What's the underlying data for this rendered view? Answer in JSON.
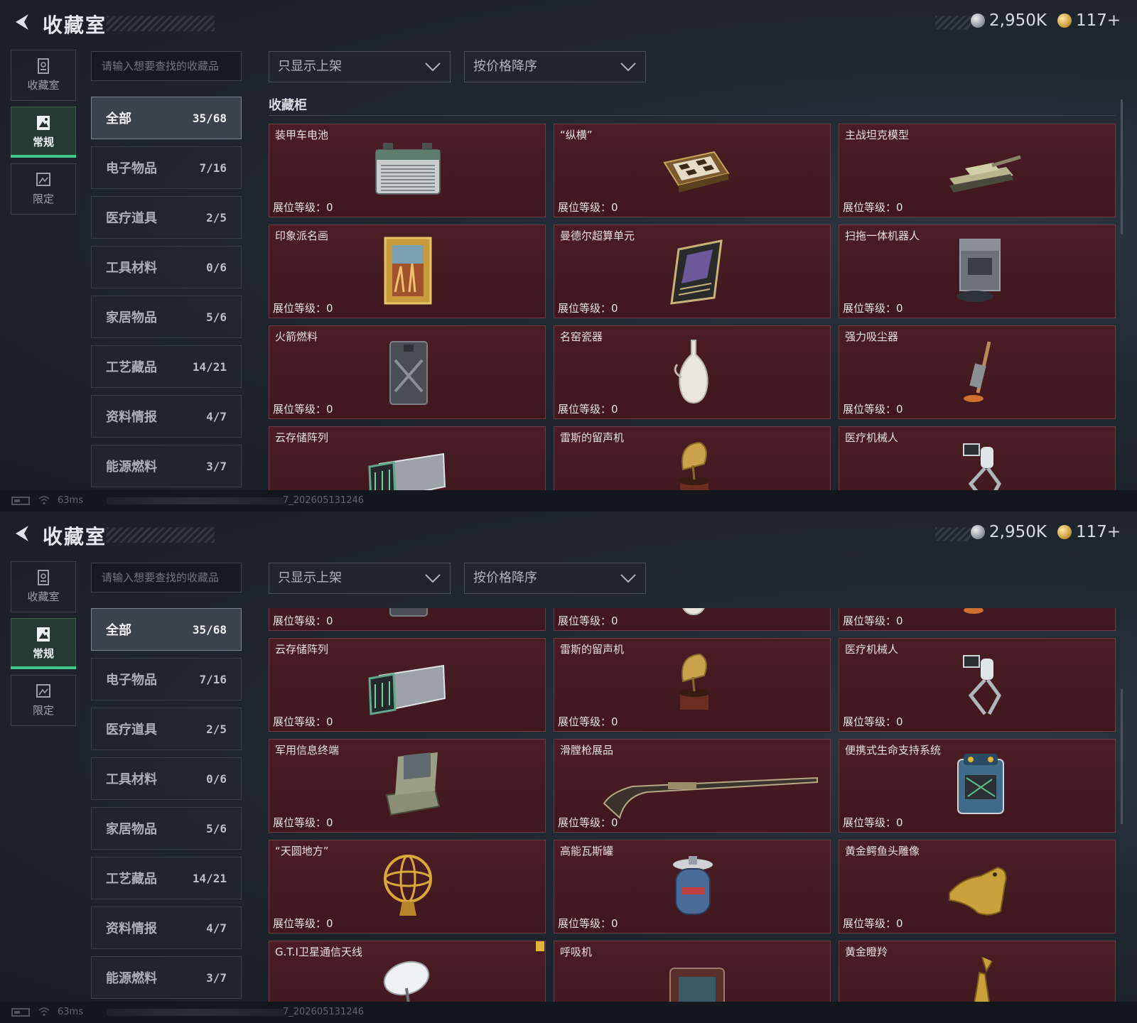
{
  "header": {
    "title": "收藏室",
    "silver": "2,950K",
    "gold": "117+"
  },
  "sidenav": [
    {
      "label": "收藏室",
      "icon": "vault-icon",
      "active": false
    },
    {
      "label": "常规",
      "icon": "photo-frame-icon",
      "active": true
    },
    {
      "label": "限定",
      "icon": "limited-picture-icon",
      "active": false
    }
  ],
  "search": {
    "placeholder": "请输入想要查找的收藏品"
  },
  "filters": {
    "display": "只显示上架",
    "sort": "按价格降序"
  },
  "section_title": "收藏柜",
  "categories": [
    {
      "name": "全部",
      "count": "35/68",
      "active": true
    },
    {
      "name": "电子物品",
      "count": "7/16"
    },
    {
      "name": "医疗道具",
      "count": "2/5"
    },
    {
      "name": "工具材料",
      "count": "0/6"
    },
    {
      "name": "家居物品",
      "count": "5/6"
    },
    {
      "name": "工艺藏品",
      "count": "14/21"
    },
    {
      "name": "资料情报",
      "count": "4/7"
    },
    {
      "name": "能源燃料",
      "count": "3/7"
    }
  ],
  "level_label": "展位等级：0",
  "items": [
    {
      "name": "装甲车电池",
      "icon": "battery-item-icon"
    },
    {
      "name": "“纵横”",
      "icon": "chessboard-item-icon"
    },
    {
      "name": "主战坦克模型",
      "icon": "tank-model-icon"
    },
    {
      "name": "印象派名画",
      "icon": "painting-item-icon"
    },
    {
      "name": "曼德尔超算单元",
      "icon": "supercomputer-unit-icon"
    },
    {
      "name": "扫拖一体机器人",
      "icon": "robot-vacuum-icon"
    },
    {
      "name": "火箭燃料",
      "icon": "fuel-can-icon"
    },
    {
      "name": "名窑瓷器",
      "icon": "porcelain-vase-icon"
    },
    {
      "name": "强力吸尘器",
      "icon": "vacuum-cleaner-icon"
    },
    {
      "name": "云存储阵列",
      "icon": "storage-array-icon"
    },
    {
      "name": "雷斯的留声机",
      "icon": "gramophone-icon"
    },
    {
      "name": "医疗机械人",
      "icon": "medical-robot-icon"
    },
    {
      "name": "军用信息终端",
      "icon": "military-terminal-icon"
    },
    {
      "name": "滑膛枪展品",
      "icon": "musket-icon"
    },
    {
      "name": "便携式生命支持系统",
      "icon": "life-support-icon"
    },
    {
      "name": "“天圆地方”",
      "icon": "armillary-sphere-icon"
    },
    {
      "name": "高能瓦斯罐",
      "icon": "gas-tank-icon"
    },
    {
      "name": "黄金鳄鱼头雕像",
      "icon": "gold-croc-statue-icon"
    },
    {
      "name": "G.T.I卫星通信天线",
      "icon": "satellite-dish-icon",
      "flag": true
    },
    {
      "name": "呼吸机",
      "icon": "ventilator-icon"
    },
    {
      "name": "黄金瞪羚",
      "icon": "gold-gazelle-icon"
    }
  ],
  "status": {
    "ping": "63ms",
    "build": "7_202605131246"
  },
  "colors": {
    "card_bg": "#4b1d24",
    "active_accent": "#3ec98a",
    "flag": "#e0b53a"
  }
}
